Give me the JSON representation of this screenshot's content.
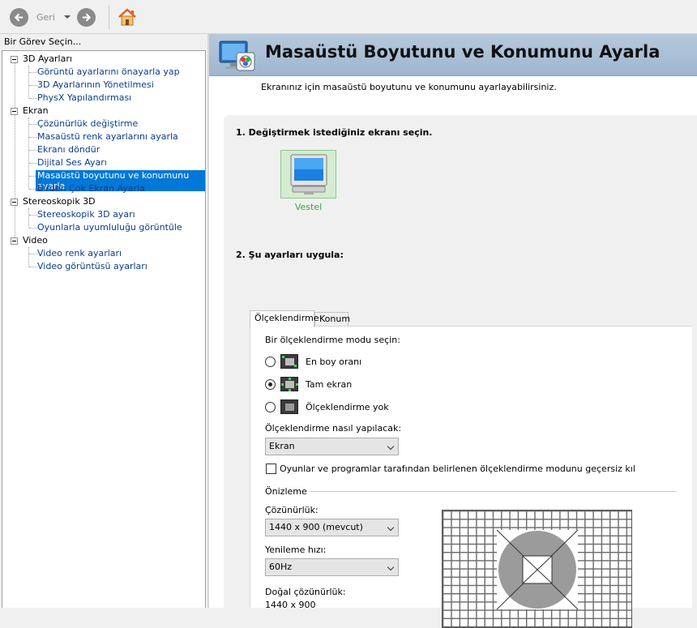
{
  "toolbar": {
    "back_label": "Geri",
    "icons": [
      "back-arrow-icon",
      "dropdown-caret-icon",
      "forward-arrow-icon",
      "home-icon"
    ]
  },
  "left": {
    "header": "Bir Görev Seçin...",
    "tree": [
      {
        "label": "3D Ayarları",
        "children": [
          "Görüntü ayarlarını önayarla yap",
          "3D Ayarlarının Yönetilmesi",
          "PhysX Yapılandırması"
        ]
      },
      {
        "label": "Ekran",
        "children": [
          "Çözünürlük değiştirme",
          "Masaüstü renk ayarlarını ayarla",
          "Ekranı döndür",
          "Dijital Ses Ayarı",
          "Masaüstü boyutunu ve konumunu ayarla",
          "Birden Çok Ekran Ayarla"
        ]
      },
      {
        "label": "Stereoskopik 3D",
        "children": [
          "Stereoskopik 3D ayarı",
          "Oyunlarla uyumluluğu görüntüle"
        ]
      },
      {
        "label": "Video",
        "children": [
          "Video renk ayarları",
          "Video görüntüsü ayarları"
        ]
      }
    ],
    "selected": "Masaüstü boyutunu ve konumunu ayarla"
  },
  "main": {
    "title": "Masaüstü Boyutunu ve Konumunu Ayarla",
    "subtitle": "Ekranınız için masaüstü boyutunu ve konumunu ayarlayabilirsiniz.",
    "step1": "1. Değiştirmek istediğiniz ekranı seçin.",
    "display_name": "Vestel",
    "step2": "2. Şu ayarları uygula:",
    "tabs": [
      "Ölçeklendirme",
      "Konum"
    ],
    "active_tab": "Ölçeklendirme",
    "scaling": {
      "prompt": "Bir ölçeklendirme modu seçin:",
      "modes": [
        "En boy oranı",
        "Tam ekran",
        "Ölçeklendirme yok"
      ],
      "selected_mode": "Tam ekran",
      "perform_label": "Ölçeklendirme nasıl yapılacak:",
      "perform_value": "Ekran",
      "override_label": "Oyunlar ve programlar tarafından belirlenen ölçeklendirme modunu geçersiz kıl",
      "override_checked": false
    },
    "preview": {
      "heading": "Önizleme",
      "resolution_label": "Çözünürlük:",
      "resolution_value": "1440 x 900 (mevcut)",
      "refresh_label": "Yenileme hızı:",
      "refresh_value": "60Hz",
      "native_label": "Doğal çözünürlük:",
      "native_value": "1440 x 900"
    }
  },
  "colors": {
    "banner": "#aec3d8",
    "selection": "#0078d7",
    "link": "#0b3c8c",
    "display_name": "#3aa548"
  }
}
